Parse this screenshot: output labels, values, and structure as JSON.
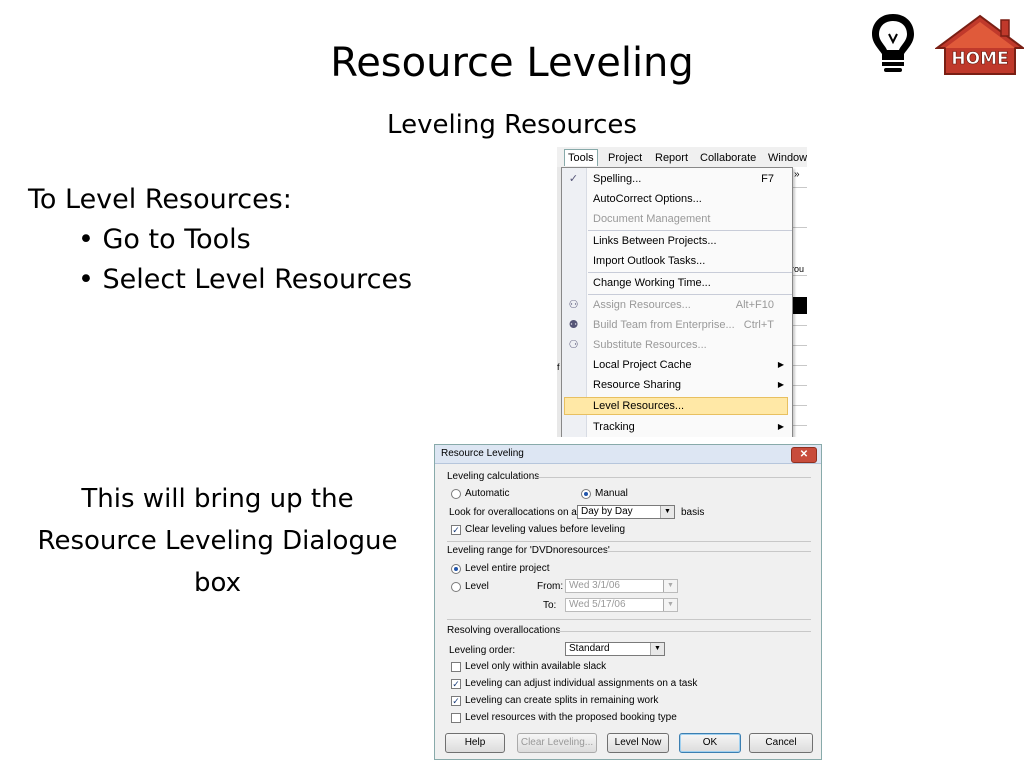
{
  "slide": {
    "title": "Resource Leveling",
    "subtitle": "Leveling Resources",
    "intro": "To Level Resources:",
    "bullets": [
      "• Go to Tools",
      "• Select Level Resources"
    ],
    "description": "This will bring up the Resource Leveling Dialogue box",
    "home_label": "HOME",
    "colors": {
      "home": "#c0392b",
      "bulb": "#000000"
    }
  },
  "menu": {
    "menubar": [
      "Tools",
      "Project",
      "Report",
      "Collaborate",
      "Window"
    ],
    "overflow": "»",
    "items": [
      {
        "label": "Spelling...",
        "shortcut": "F7",
        "icon": "spelling-icon"
      },
      {
        "label": "AutoCorrect Options..."
      },
      {
        "label": "Document Management",
        "disabled": true
      },
      {
        "label": "Links Between Projects..."
      },
      {
        "label": "Import Outlook Tasks..."
      },
      {
        "label": "Change Working Time..."
      },
      {
        "label": "Assign Resources...",
        "shortcut": "Alt+F10",
        "disabled": true,
        "icon": "assign-resources-icon"
      },
      {
        "label": "Build Team from Enterprise...",
        "shortcut": "Ctrl+T",
        "disabled": true,
        "icon": "build-team-icon"
      },
      {
        "label": "Substitute Resources...",
        "disabled": true,
        "icon": "substitute-resources-icon"
      },
      {
        "label": "Local Project Cache",
        "submenu": true
      },
      {
        "label": "Resource Sharing",
        "submenu": true
      },
      {
        "label": "Level Resources...",
        "highlighted": true
      },
      {
        "label": "Tracking",
        "submenu": true
      }
    ],
    "bg_fragment_text": "rou",
    "bg_left_text": "f"
  },
  "dialog": {
    "title": "Resource Leveling",
    "close": "✕",
    "calc_group": "Leveling calculations",
    "automatic": "Automatic",
    "manual": "Manual",
    "look_for": "Look for overallocations on a",
    "basis_value": "Day by Day",
    "basis": "basis",
    "clear_before": "Clear leveling values before leveling",
    "range_group": "Leveling range for 'DVDnoresources'",
    "level_entire": "Level entire project",
    "level": "Level",
    "from": "From:",
    "from_value": "Wed 3/1/06",
    "to": "To:",
    "to_value": "Wed 5/17/06",
    "resolving_group": "Resolving overallocations",
    "order": "Leveling order:",
    "order_value": "Standard",
    "within_slack": "Level only within available slack",
    "adjust_assignments": "Leveling can adjust individual assignments on a task",
    "create_splits": "Leveling can create splits in remaining work",
    "proposed_booking": "Level resources with the proposed booking type",
    "buttons": {
      "help": "Help",
      "clear": "Clear Leveling...",
      "level_now": "Level Now",
      "ok": "OK",
      "cancel": "Cancel"
    }
  }
}
